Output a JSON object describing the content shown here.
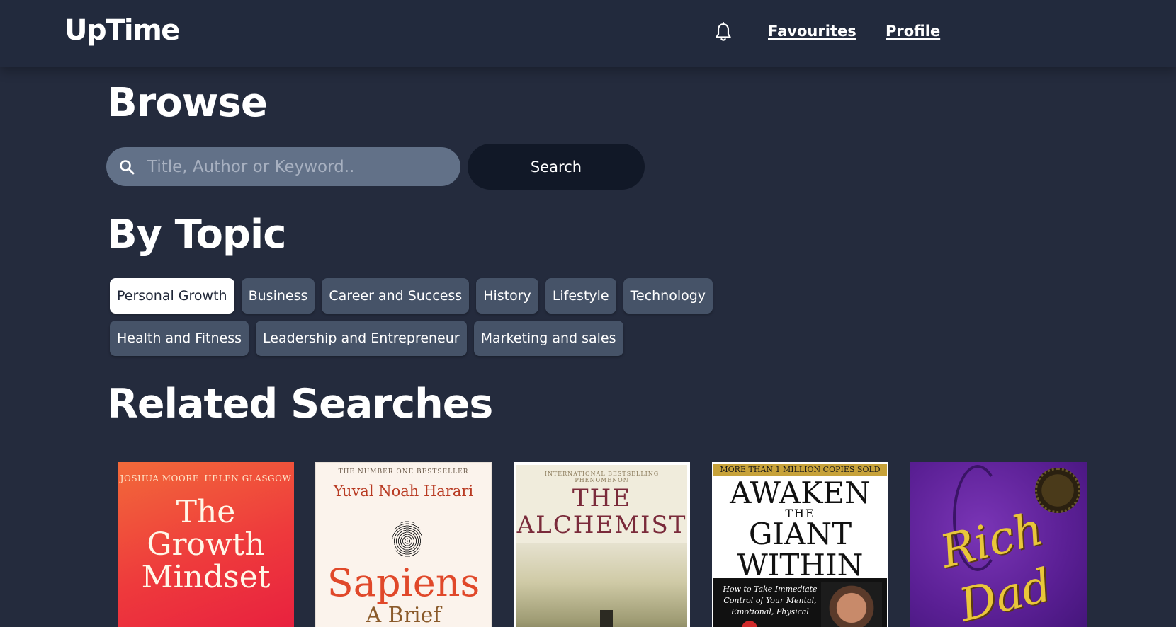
{
  "header": {
    "logo": "UpTime",
    "nav": {
      "favourites": "Favourites",
      "profile": "Profile"
    },
    "icons": {
      "notifications": "bell-icon"
    }
  },
  "browse": {
    "heading": "Browse",
    "search": {
      "placeholder": "Title, Author or Keyword..",
      "value": "",
      "icon": "search-icon",
      "button_label": "Search"
    }
  },
  "topics": {
    "heading": "By Topic",
    "active": "Personal Growth",
    "rows": [
      [
        "Personal Growth",
        "Business",
        "Career and Success",
        "History",
        "Lifestyle",
        "Technology"
      ],
      [
        "Health and Fitness",
        "Leadership and Entrepreneur",
        "Marketing and sales"
      ]
    ]
  },
  "related": {
    "heading": "Related Searches",
    "books": [
      {
        "authors": [
          "JOSHUA MOORE",
          "HELEN GLASGOW"
        ],
        "title_lines": [
          "The",
          "Growth",
          "Mindset"
        ]
      },
      {
        "tagline": "THE NUMBER ONE BESTSELLER",
        "author": "Yuval Noah Harari",
        "title": "Sapiens",
        "subtitle": "A Brief"
      },
      {
        "tagline": "INTERNATIONAL BESTSELLING PHENOMENON",
        "title_lines": [
          "THE",
          "ALCHEMIST"
        ]
      },
      {
        "banner": "MORE THAN 1 MILLION COPIES SOLD",
        "title_lines": [
          "AWAKEN",
          "THE",
          "GIANT",
          "WITHIN"
        ],
        "blurb": "How to Take Immediate Control of Your Mental, Emotional, Physical"
      },
      {
        "title_lines": [
          "Rich",
          "Dad"
        ]
      }
    ]
  },
  "colors": {
    "background": "#242b3d",
    "header": "#222a3d",
    "search_field": "#627188",
    "search_button": "#111827",
    "chip": "#465368",
    "chip_active": "#ffffff"
  }
}
